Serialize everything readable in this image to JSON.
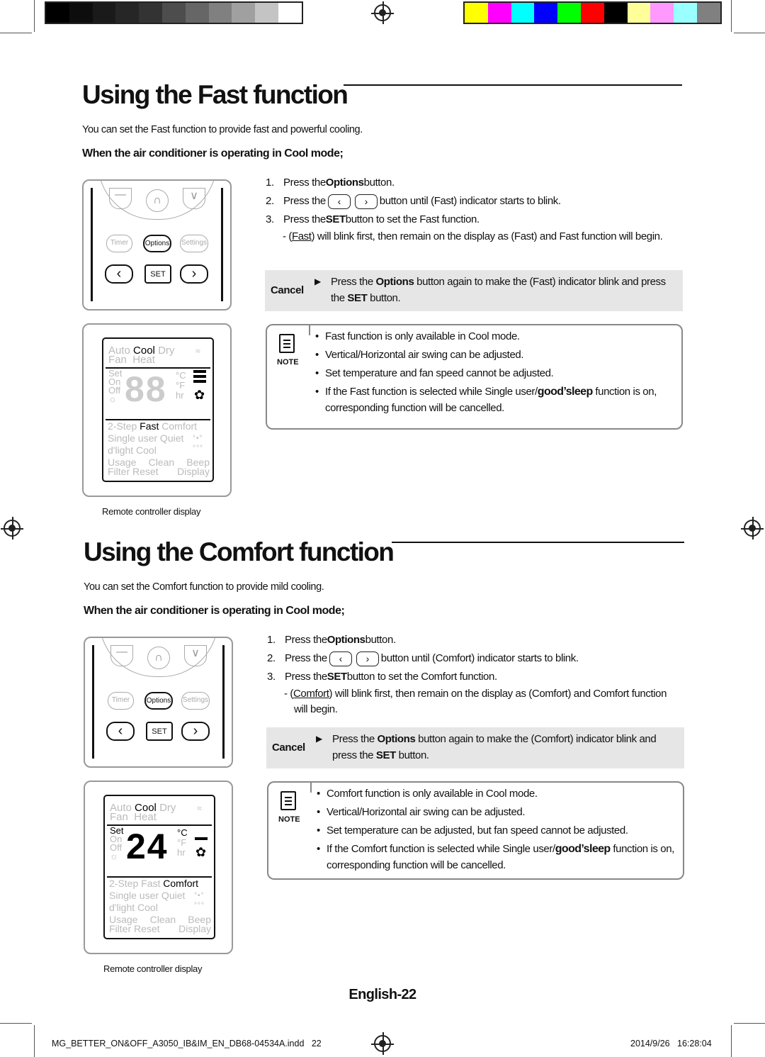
{
  "color_bars": {
    "grayscale": [
      "#000000",
      "#0d0d0d",
      "#1a1a1a",
      "#262626",
      "#333333",
      "#4d4d4d",
      "#666666",
      "#808080",
      "#a0a0a0",
      "#c4c4c4",
      "#ffffff"
    ],
    "colors": [
      "#ffff00",
      "#ff00ff",
      "#00ffff",
      "#0000ff",
      "#00ff00",
      "#ff0000",
      "#000000",
      "#ffff99",
      "#ff99ff",
      "#99ffff",
      "#808080"
    ]
  },
  "sections": [
    {
      "title": "Using the Fast function",
      "intro": "You can set the Fast function to provide fast and powerful cooling.",
      "subheading": "When the air conditioner is operating in Cool mode;",
      "steps": [
        {
          "n": "1.",
          "parts": [
            {
              "t": "Press the "
            },
            {
              "t": "Options",
              "s": "b"
            },
            {
              "t": " button."
            }
          ]
        },
        {
          "n": "2.",
          "parts": [
            {
              "t": "Press the "
            },
            {
              "icon": "left"
            },
            {
              "icon": "right"
            },
            {
              "t": " button until (Fast) indicator starts to blink."
            }
          ]
        },
        {
          "n": "3.",
          "parts": [
            {
              "t": "Press the "
            },
            {
              "t": "SET",
              "s": "b"
            },
            {
              "t": " button to set the Fast function."
            }
          ]
        }
      ],
      "subnote": [
        {
          "t": "- ("
        },
        {
          "t": "Fast",
          "s": "u"
        },
        {
          "t": ") will blink first, then remain on the display as (Fast) and Fast function will begin."
        }
      ],
      "cancel": {
        "label": "Cancel",
        "parts": [
          {
            "t": "Press the "
          },
          {
            "t": "Options",
            "s": "b"
          },
          {
            "t": " button again to make the (Fast) indicator blink and press the "
          },
          {
            "t": "SET",
            "s": "b"
          },
          {
            "t": " button."
          }
        ]
      },
      "note": {
        "label": "NOTE",
        "items": [
          [
            {
              "t": "Fast function is only available in Cool mode."
            }
          ],
          [
            {
              "t": "Vertical/Horizontal air swing can be adjusted."
            }
          ],
          [
            {
              "t": "Set temperature and fan speed cannot be adjusted."
            }
          ],
          [
            {
              "t": "If  the Fast function is selected while Single user/"
            },
            {
              "t": "good’sleep",
              "s": "gs"
            },
            {
              "t": " function is on, corresponding function will be cancelled."
            }
          ]
        ]
      },
      "remote": {
        "buttons": [
          "Timer",
          "Options",
          "Settings",
          "SET"
        ],
        "active_button": "Options"
      },
      "display": {
        "digits": "88",
        "digits_active": false,
        "set_active": false,
        "active_mode": "Cool",
        "active_function": "Fast",
        "fan_bars": 3
      },
      "caption": "Remote controller display"
    },
    {
      "title": "Using the Comfort function",
      "intro": "You can set the Comfort function to provide mild cooling.",
      "subheading": "When the air conditioner is operating in Cool mode;",
      "steps": [
        {
          "n": "1.",
          "parts": [
            {
              "t": "Press the "
            },
            {
              "t": "Options",
              "s": "b"
            },
            {
              "t": " button."
            }
          ]
        },
        {
          "n": "2.",
          "parts": [
            {
              "t": "Press the "
            },
            {
              "icon": "left"
            },
            {
              "icon": "right"
            },
            {
              "t": " button until (Comfort) indicator starts to blink."
            }
          ]
        },
        {
          "n": "3.",
          "parts": [
            {
              "t": "Press the "
            },
            {
              "t": "SET",
              "s": "b"
            },
            {
              "t": " button to set the Comfort function."
            }
          ]
        }
      ],
      "subnote": [
        {
          "t": "- ("
        },
        {
          "t": "Comfort",
          "s": "u"
        },
        {
          "t": ") will blink first, then remain on the display as (Comfort) and Comfort function will begin."
        }
      ],
      "cancel": {
        "label": "Cancel",
        "parts": [
          {
            "t": "Press the "
          },
          {
            "t": "Options",
            "s": "b"
          },
          {
            "t": " button again to make the (Comfort) indicator blink and press the "
          },
          {
            "t": "SET",
            "s": "b"
          },
          {
            "t": " button."
          }
        ]
      },
      "note": {
        "label": "NOTE",
        "items": [
          [
            {
              "t": "Comfort function is only available in Cool mode."
            }
          ],
          [
            {
              "t": "Vertical/Horizontal air swing can be adjusted."
            }
          ],
          [
            {
              "t": "Set temperature can be adjusted, but fan speed cannot be adjusted."
            }
          ],
          [
            {
              "t": "If the Comfort function is selected while Single user/"
            },
            {
              "t": "good’sleep",
              "s": "gs"
            },
            {
              "t": " function is on, corresponding function will be cancelled."
            }
          ]
        ]
      },
      "remote": {
        "buttons": [
          "Timer",
          "Options",
          "Settings",
          "SET"
        ],
        "active_button": "Options"
      },
      "display": {
        "digits": "24",
        "digits_active": true,
        "set_active": true,
        "active_mode": "Cool",
        "active_function": "Comfort",
        "fan_bars": 1
      },
      "caption": "Remote controller display"
    }
  ],
  "display_labels": {
    "modes_row1": [
      "Auto",
      "Cool",
      "Dry"
    ],
    "modes_row2": [
      "Fan",
      "Heat"
    ],
    "left": [
      "Set",
      "On",
      "Off"
    ],
    "units": [
      "°C",
      "°F",
      "hr"
    ],
    "functions": [
      "2-Step",
      "Fast",
      "Comfort"
    ],
    "row_a": "Single user Quiet",
    "row_b": "d'light Cool",
    "row_c": [
      "Usage",
      "Clean",
      "Beep"
    ],
    "row_d": [
      "Filter Reset",
      "Display"
    ]
  },
  "page_number": "English-22",
  "footer": {
    "file": "MG_BETTER_ON&OFF_A3050_IB&IM_EN_DB68-04534A.indd   22",
    "datetime": "2014/9/26   16:28:04"
  }
}
